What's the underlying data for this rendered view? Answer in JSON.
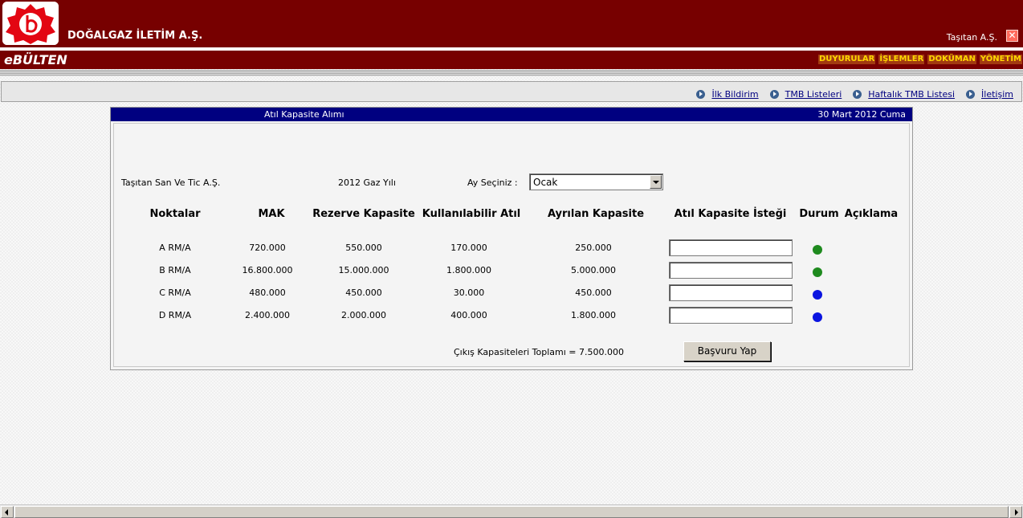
{
  "header": {
    "company_name": "DOĞALGAZ İLETİM A.Ş.",
    "user_name": "Taşıtan A.Ş.",
    "app_name": "eBÜLTEN",
    "menu": [
      "DUYURULAR",
      "İŞLEMLER",
      "DOKÜMAN",
      "YÖNETİM"
    ],
    "brand_color": "#770000",
    "menu_text_color": "#ffd700"
  },
  "nav": {
    "links": [
      "İlk Bildirim",
      "TMB Listeleri",
      "Haftalık TMB Listesi",
      "İletişim"
    ]
  },
  "panel": {
    "title": "Atıl Kapasite Alımı",
    "date": "30 Mart 2012 Cuma",
    "company": "Taşıtan San Ve Tic A.Ş.",
    "gas_year": "2012 Gaz Yılı",
    "month_label": "Ay Seçiniz :",
    "month_value": "Ocak",
    "columns": [
      "Noktalar",
      "MAK",
      "Rezerve Kapasite",
      "Kullanılabilir Atıl",
      "Ayrılan Kapasite",
      "Atıl Kapasite İsteği",
      "Durum",
      "Açıklama"
    ],
    "rows": [
      {
        "point": "A RM/A",
        "mak": "720.000",
        "reserved": "550.000",
        "available": "170.000",
        "allocated": "250.000",
        "request": "",
        "status": "green"
      },
      {
        "point": "B RM/A",
        "mak": "16.800.000",
        "reserved": "15.000.000",
        "available": "1.800.000",
        "allocated": "5.000.000",
        "request": "",
        "status": "green"
      },
      {
        "point": "C RM/A",
        "mak": "480.000",
        "reserved": "450.000",
        "available": "30.000",
        "allocated": "450.000",
        "request": "",
        "status": "blue"
      },
      {
        "point": "D RM/A",
        "mak": "2.400.000",
        "reserved": "2.000.000",
        "available": "400.000",
        "allocated": "1.800.000",
        "request": "",
        "status": "blue"
      }
    ],
    "status_colors": {
      "green": "#1e8a1e",
      "blue": "#0a14e0"
    },
    "total_text": "Çıkış Kapasiteleri Toplamı = 7.500.000",
    "submit_label": "Başvuru Yap"
  }
}
